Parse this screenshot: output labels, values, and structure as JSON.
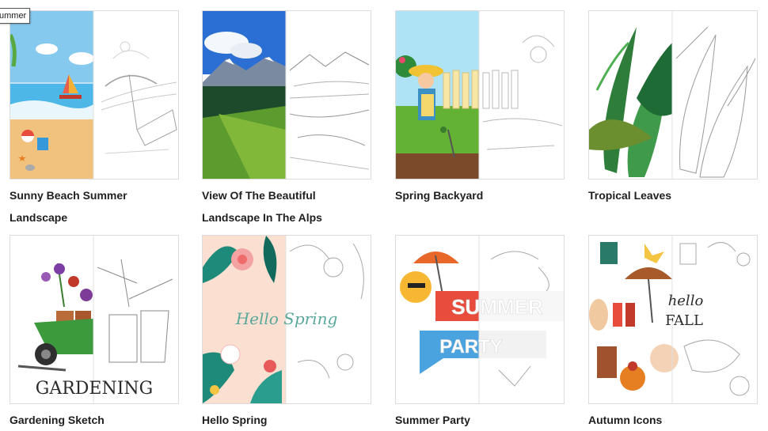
{
  "tooltip": "ummer",
  "cards": [
    {
      "title": "Sunny Beach Summer Landscape"
    },
    {
      "title": "View Of The Beautiful Landscape In The Alps"
    },
    {
      "title": "Spring Backyard"
    },
    {
      "title": "Tropical Leaves"
    },
    {
      "title": "Gardening Sketch",
      "art_text": "GARDENING"
    },
    {
      "title": "Hello Spring",
      "art_text": "Hello Spring"
    },
    {
      "title": "Summer Party",
      "art_text_1": "SUMMER",
      "art_text_2": "PARTY"
    },
    {
      "title": "Autumn Icons",
      "art_text_1": "hello",
      "art_text_2": "FALL"
    }
  ]
}
